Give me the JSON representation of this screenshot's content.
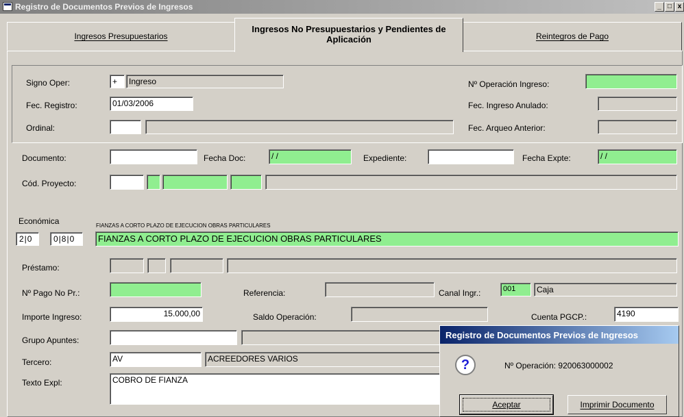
{
  "window": {
    "title": "Registro de Documentos Previos de Ingresos"
  },
  "tabs": [
    {
      "label": "Ingresos Presupuestarios"
    },
    {
      "label": "Ingresos No Presupuestarios y Pendientes de Aplicación"
    },
    {
      "label": "Reintegros de Pago"
    }
  ],
  "form": {
    "signo_oper": {
      "label": "Signo Oper:",
      "sign": "+",
      "desc": "Ingreso"
    },
    "num_operacion_ingreso": {
      "label": "Nº Operación Ingreso:",
      "value": ""
    },
    "fec_registro": {
      "label": "Fec. Registro:",
      "value": "01/03/2006"
    },
    "fec_ingreso_anulado": {
      "label": "Fec. Ingreso Anulado:",
      "value": ""
    },
    "ordinal": {
      "label": "Ordinal:",
      "code": "",
      "desc": ""
    },
    "fec_arqueo_anterior": {
      "label": "Fec. Arqueo Anterior:",
      "value": ""
    },
    "documento": {
      "label": "Documento:",
      "value": ""
    },
    "fecha_doc": {
      "label": "Fecha Doc:",
      "value": " / /"
    },
    "expediente": {
      "label": "Expediente:",
      "value": ""
    },
    "fecha_expte": {
      "label": "Fecha Expte:",
      "value": " / /"
    },
    "cod_proyecto": {
      "label": "Cód. Proyecto:"
    },
    "economica": {
      "label": "Económica",
      "caption": "FIANZAS A CORTO PLAZO DE EJECUCION OBRAS PARTICULARES",
      "code1": "2|0",
      "code2": "0|8|0",
      "desc": "FIANZAS A CORTO PLAZO DE EJECUCION OBRAS PARTICULARES"
    },
    "prestamo": {
      "label": "Préstamo:"
    },
    "num_pago": {
      "label": "Nº Pago No Pr.:",
      "value": ""
    },
    "referencia": {
      "label": "Referencia:",
      "value": ""
    },
    "canal_ingr": {
      "label": "Canal Ingr.:",
      "code": "001",
      "desc": "Caja"
    },
    "importe_ingreso": {
      "label": "Importe Ingreso:",
      "value": "15.000,00"
    },
    "saldo_operacion": {
      "label": "Saldo Operación:",
      "value": ""
    },
    "cuenta_pgcp": {
      "label": "Cuenta PGCP.:",
      "value": "4190"
    },
    "grupo_apuntes": {
      "label": "Grupo Apuntes:",
      "value": ""
    },
    "tercero": {
      "label": "Tercero:",
      "code": "AV",
      "desc": "ACREEDORES VARIOS"
    },
    "texto_expl": {
      "label": "Texto Expl:",
      "value": "COBRO DE FIANZA"
    }
  },
  "dialog": {
    "title": "Registro de Documentos Previos de Ingresos",
    "message": "Nº Operación: 920063000002",
    "ok_label": "Aceptar",
    "print_label": "Imprimir Documento"
  }
}
